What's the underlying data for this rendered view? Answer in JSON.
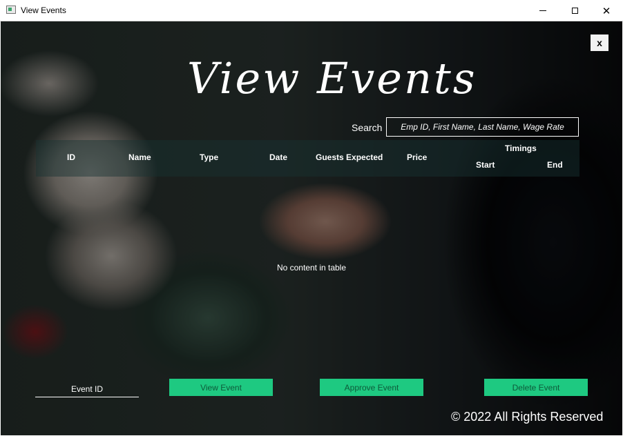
{
  "window": {
    "title": "View Events",
    "minimize": "—",
    "maximize": "☐",
    "close": "✕"
  },
  "heading": "View Events",
  "close_button": "x",
  "search": {
    "label": "Search",
    "placeholder": "Emp ID, First Name, Last Name, Wage Rate"
  },
  "table": {
    "columns": [
      "ID",
      "Name",
      "Type",
      "Date",
      "Guests Expected",
      "Price"
    ],
    "timings": {
      "label": "Timings",
      "start": "Start",
      "end": "End"
    },
    "empty_text": "No content in table"
  },
  "event_id": {
    "placeholder": "Event ID"
  },
  "actions": {
    "view": "View Event",
    "approve": "Approve Event",
    "delete": "Delete Event"
  },
  "footer": "© 2022 All Rights Reserved",
  "colors": {
    "button_green": "#1ec981",
    "button_text": "#0e5a3a"
  }
}
